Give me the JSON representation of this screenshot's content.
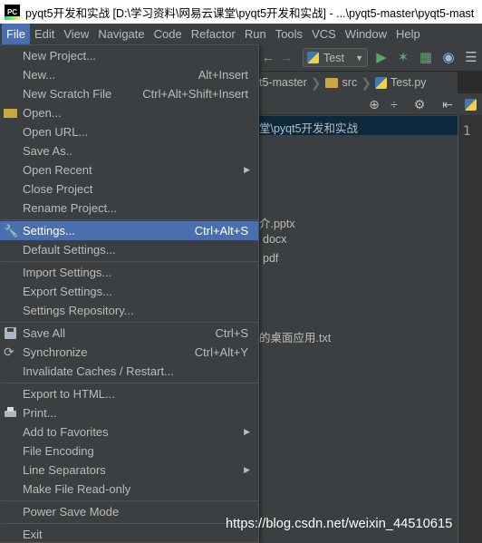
{
  "window": {
    "title": "pyqt5开发和实战 [D:\\学习资料\\网易云课堂\\pyqt5开发和实战] - ...\\pyqt5-master\\pyqt5-mast",
    "app_icon_text": "PC"
  },
  "menubar": {
    "items": [
      "File",
      "Edit",
      "View",
      "Navigate",
      "Code",
      "Refactor",
      "Run",
      "Tools",
      "VCS",
      "Window",
      "Help"
    ]
  },
  "toolbar": {
    "run_config": "Test"
  },
  "breadcrumb": {
    "items": [
      "t5-master",
      "src",
      "Test.py"
    ]
  },
  "project_tree": {
    "selected_path": "堂\\pyqt5开发和实战",
    "rows": [
      "介.pptx",
      "docx",
      "pdf",
      "的桌面应用.txt"
    ]
  },
  "editor": {
    "line_number": "1"
  },
  "file_menu": {
    "items": [
      {
        "label": "New Project...",
        "shortcut": ""
      },
      {
        "label": "New...",
        "shortcut": "Alt+Insert"
      },
      {
        "label": "New Scratch File",
        "shortcut": "Ctrl+Alt+Shift+Insert"
      },
      {
        "label": "Open...",
        "shortcut": ""
      },
      {
        "label": "Open URL...",
        "shortcut": ""
      },
      {
        "label": "Save As..",
        "shortcut": ""
      },
      {
        "label": "Open Recent",
        "shortcut": ""
      },
      {
        "label": "Close Project",
        "shortcut": ""
      },
      {
        "label": "Rename Project...",
        "shortcut": ""
      },
      {
        "label": "Settings...",
        "shortcut": "Ctrl+Alt+S"
      },
      {
        "label": "Default Settings...",
        "shortcut": ""
      },
      {
        "label": "Import Settings...",
        "shortcut": ""
      },
      {
        "label": "Export Settings...",
        "shortcut": ""
      },
      {
        "label": "Settings Repository...",
        "shortcut": ""
      },
      {
        "label": "Save All",
        "shortcut": "Ctrl+S"
      },
      {
        "label": "Synchronize",
        "shortcut": "Ctrl+Alt+Y"
      },
      {
        "label": "Invalidate Caches / Restart...",
        "shortcut": ""
      },
      {
        "label": "Export to HTML...",
        "shortcut": ""
      },
      {
        "label": "Print...",
        "shortcut": ""
      },
      {
        "label": "Add to Favorites",
        "shortcut": ""
      },
      {
        "label": "File Encoding",
        "shortcut": ""
      },
      {
        "label": "Line Separators",
        "shortcut": ""
      },
      {
        "label": "Make File Read-only",
        "shortcut": ""
      },
      {
        "label": "Power Save Mode",
        "shortcut": ""
      },
      {
        "label": "Exit",
        "shortcut": ""
      }
    ]
  },
  "watermark": "https://blog.csdn.net/weixin_44510615",
  "colors": {
    "menu_bg": "#3c3f41",
    "selection": "#4b6eaf",
    "text": "#bbbbbb",
    "editor_bg": "#2b2b2b"
  }
}
